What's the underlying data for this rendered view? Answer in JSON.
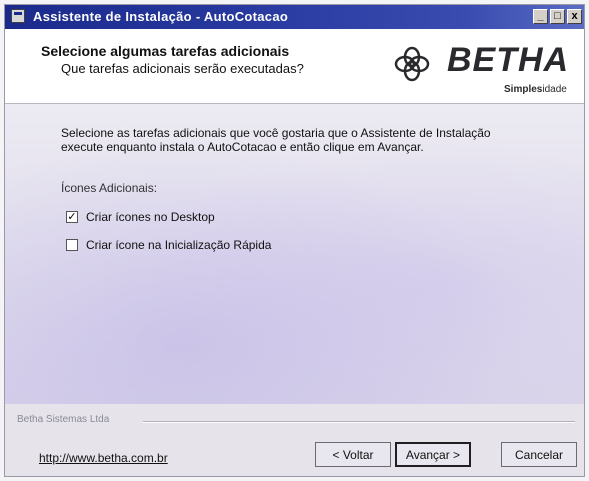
{
  "window": {
    "title": "Assistente de Instalação - AutoCotacao",
    "controls": {
      "minimize": "_",
      "maximize": "□",
      "close": "x"
    }
  },
  "header": {
    "title": "Selecione algumas tarefas adicionais",
    "subtitle": "Que tarefas adicionais serão executadas?",
    "logo": {
      "brand": "BETHA",
      "tagline_bold": "Simples",
      "tagline_rest": "idade",
      "icon": "betha-knot-icon"
    }
  },
  "content": {
    "description": "Selecione as tarefas adicionais que você gostaria que o Assistente de Instalação execute enquanto instala o AutoCotacao e então clique em Avançar.",
    "group_label": "Ícones Adicionais:",
    "tasks": [
      {
        "label": "Criar ícones no Desktop",
        "checked": true,
        "mark": "✓"
      },
      {
        "label": "Criar ícone na Inicialização Rápida",
        "checked": false,
        "mark": ""
      }
    ]
  },
  "footer": {
    "separator_text": "Betha Sistemas Ltda",
    "link": "http://www.betha.com.br",
    "buttons": {
      "back": "< Voltar",
      "next": "Avançar >",
      "cancel": "Cancelar"
    }
  }
}
